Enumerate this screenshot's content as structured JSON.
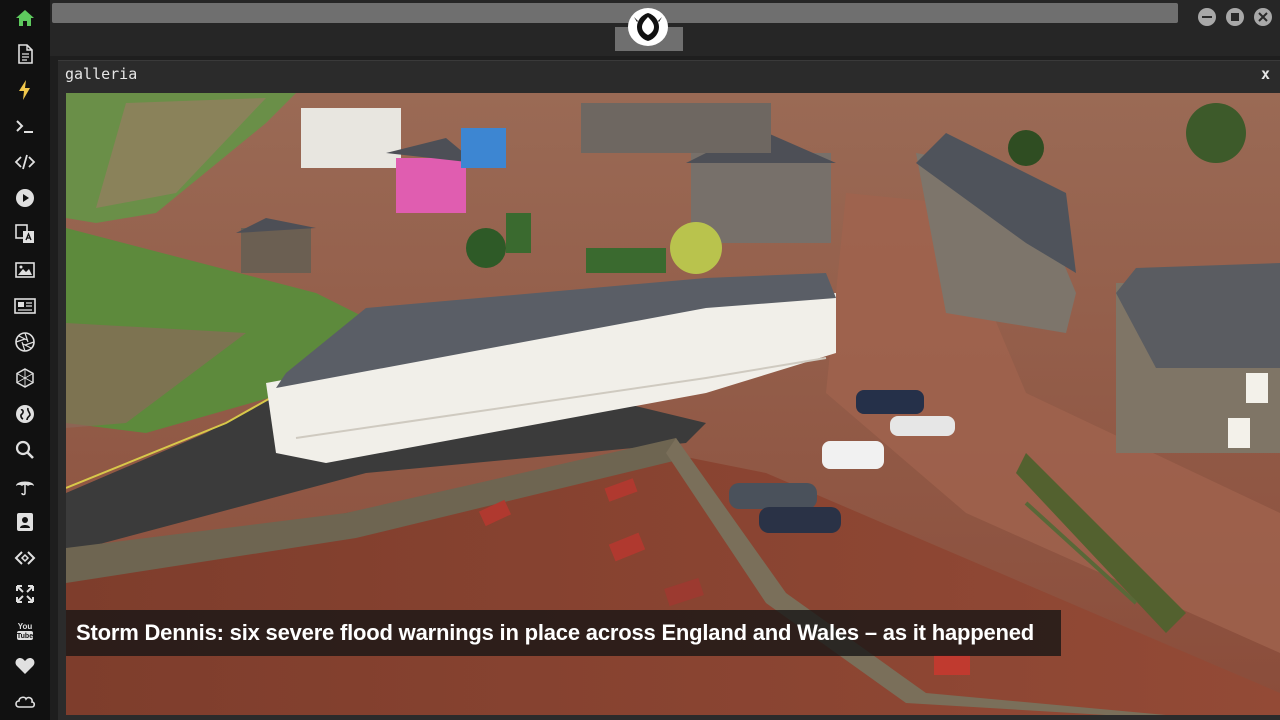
{
  "window": {
    "title": "galleria",
    "close_label": "x"
  },
  "caption": {
    "text": "Storm Dennis: six severe flood warnings in place across England and Wales – as it happened"
  },
  "sidebar": {
    "icons": [
      "home-icon",
      "document-icon",
      "lightning-icon",
      "terminal-icon",
      "code-icon",
      "play-icon",
      "translate-icon",
      "image-icon",
      "news-icon",
      "aperture-icon",
      "hexagon-icon",
      "globe-icon",
      "search-icon",
      "umbrella-icon",
      "contact-icon",
      "link-icon",
      "fullscreen-icon",
      "youtube-icon",
      "heart-icon",
      "cloud-icon"
    ]
  },
  "topbar": {
    "logo": "rebel-alliance-icon",
    "window_buttons": [
      "minimize-icon",
      "maximize-icon",
      "close-icon"
    ]
  },
  "colors": {
    "sidebar_bg": "#111111",
    "active_icon": "#5ec95e",
    "icon": "#e0e0e0",
    "flood_water": "#8f5a45",
    "caption_bg": "#141414"
  }
}
